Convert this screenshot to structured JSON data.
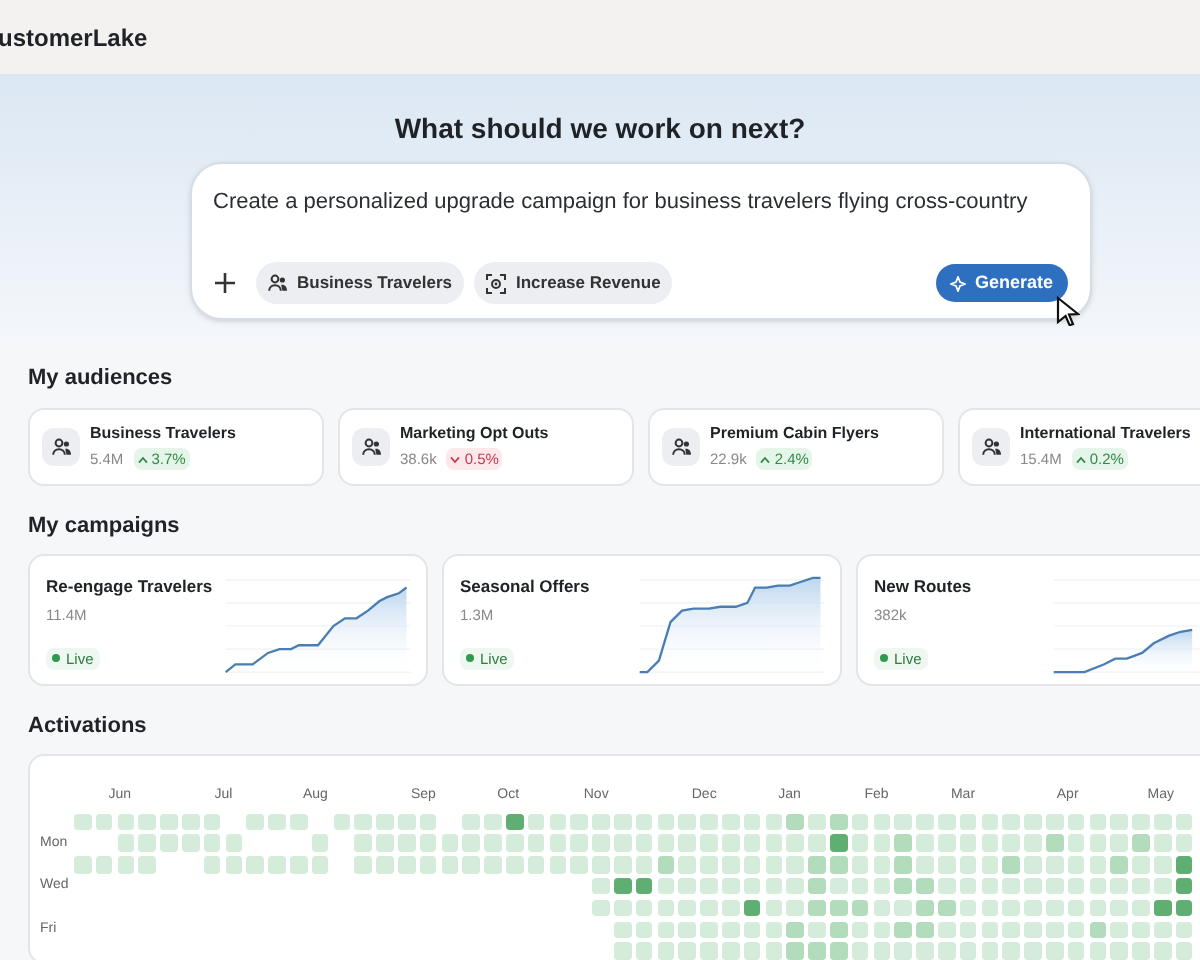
{
  "app": {
    "title": "ustomerLake"
  },
  "prompt": {
    "heading": "What should we work on next?",
    "value": "Create a personalized upgrade campaign for business travelers flying cross-country",
    "chips": [
      {
        "label": "Business Travelers",
        "kind": "audience"
      },
      {
        "label": "Increase Revenue",
        "kind": "goal"
      }
    ],
    "button": "Generate"
  },
  "audiences": {
    "title": "My audiences",
    "items": [
      {
        "name": "Business Travelers",
        "size": "5.4M",
        "change": "3.7%",
        "rising": true
      },
      {
        "name": "Marketing Opt Outs",
        "size": "38.6k",
        "change": "0.5%",
        "rising": false
      },
      {
        "name": "Premium Cabin Flyers",
        "size": "22.9k",
        "change": "2.4%",
        "rising": true
      },
      {
        "name": "International Travelers",
        "size": "15.4M",
        "change": "0.2%",
        "rising": true
      }
    ]
  },
  "campaigns": {
    "title": "My campaigns",
    "items": [
      {
        "name": "Re-engage Travelers",
        "size": "11.4M",
        "status": "Live"
      },
      {
        "name": "Seasonal Offers",
        "size": "1.3M",
        "status": "Live"
      },
      {
        "name": "New Routes",
        "size": "382k",
        "status": "Live"
      }
    ]
  },
  "activations": {
    "title": "Activations",
    "months": [
      "Jun",
      "Jul",
      "Aug",
      "Sep",
      "Oct",
      "Nov",
      "Dec",
      "Jan",
      "Feb",
      "Mar",
      "Apr",
      "May"
    ],
    "days": [
      "Mon",
      "Wed",
      "Fri"
    ]
  }
}
